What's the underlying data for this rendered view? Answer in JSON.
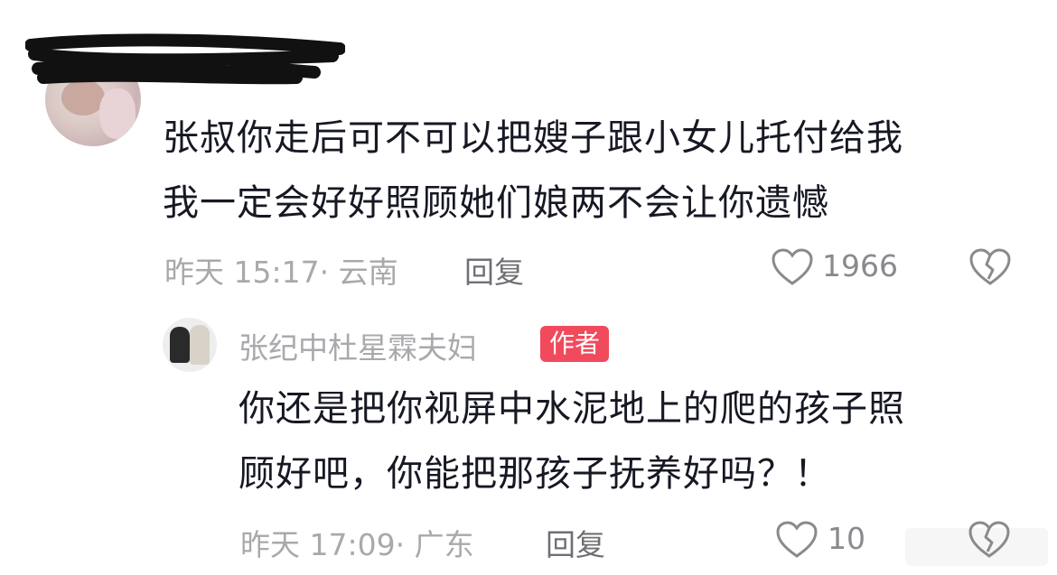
{
  "comment": {
    "line1": "张叔你走后可不可以把嫂子跟小女儿托付给我",
    "line2": "我一定会好好照顾她们娘两不会让你遗憾",
    "time_location": "昨天 15:17· 云南",
    "reply_label": "回复",
    "likes": "1966"
  },
  "reply": {
    "username": "张纪中杜星霖夫妇",
    "badge": "作者",
    "line1": "你还是把你视屏中水泥地上的爬的孩子照",
    "line2": "顾好吧，你能把那孩子抚养好吗？！",
    "time_location": "昨天 17:09· 广东",
    "reply_label": "回复",
    "likes": "10"
  },
  "colors": {
    "text": "#161823",
    "meta": "#a9a9ad",
    "badge": "#f04a5c"
  }
}
